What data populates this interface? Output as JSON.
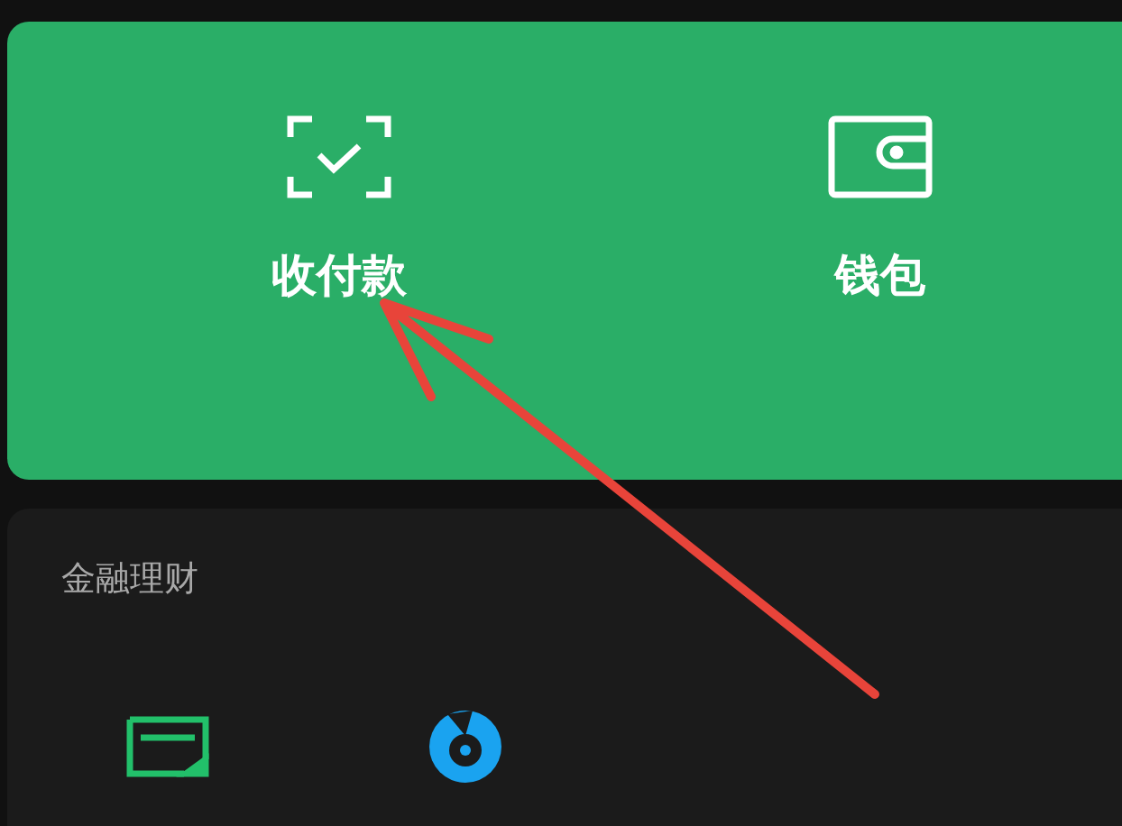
{
  "pay_panel": {
    "actions": [
      {
        "label": "收付款"
      },
      {
        "label": "钱包"
      }
    ]
  },
  "finance": {
    "title": "金融理财"
  }
}
